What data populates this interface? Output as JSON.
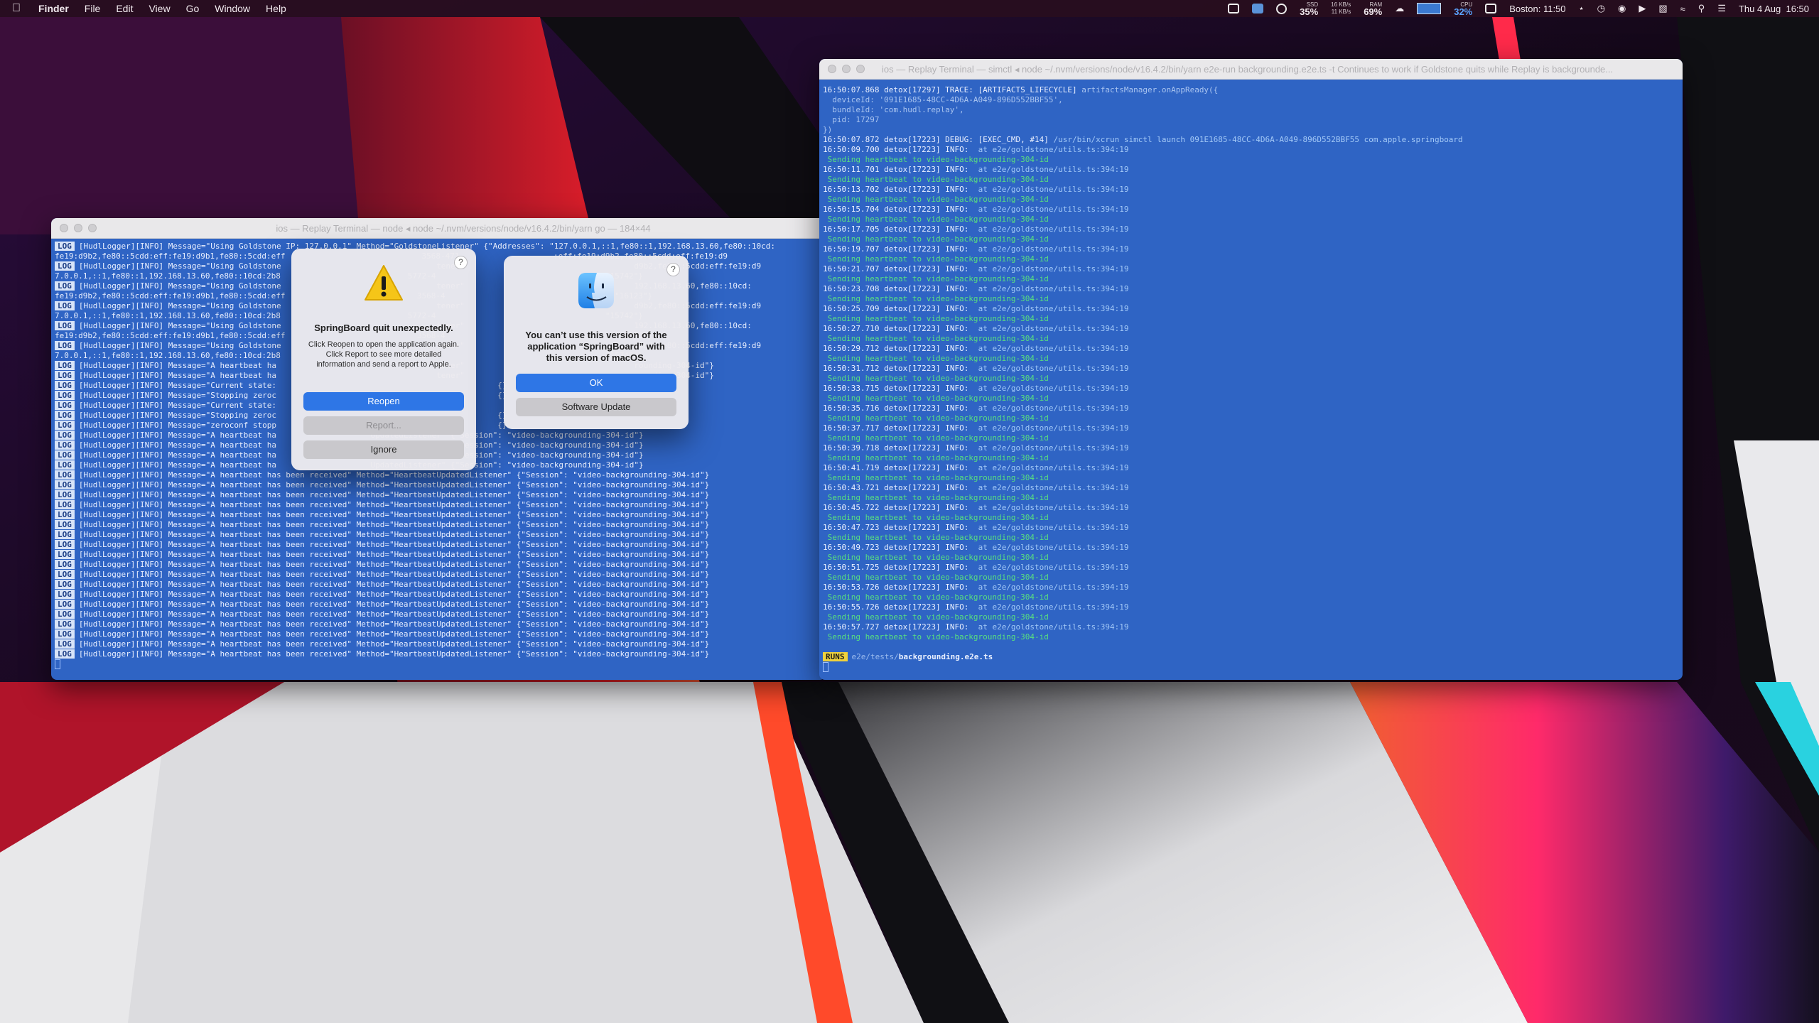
{
  "menubar": {
    "app_name": "Finder",
    "menus": [
      "File",
      "Edit",
      "View",
      "Go",
      "Window",
      "Help"
    ],
    "ssd": {
      "label": "SSD",
      "value": "35%"
    },
    "network": {
      "up": "16 KB/s",
      "down": "11 KB/s"
    },
    "ram": {
      "label": "RAM",
      "value": "69%"
    },
    "cpu": {
      "label": "CPU",
      "value": "32%"
    },
    "clock_city": "Boston: 11:50",
    "datetime": "Thu 4 Aug  16:50"
  },
  "term_left": {
    "title": "ios — Replay Terminal — node ◂ node ~/.nvm/versions/node/v16.4.2/bin/yarn go — 184×44",
    "lines": [
      {
        "badge": "LOG",
        "text": "[HudlLogger][INFO] Message=\"Using Goldstone IP: 127.0.0.1\" Method=\"GoldstoneListener\" {\"Addresses\": \"127.0.0.1,::1,fe80::1,192.168.13.60,fe80::10cd:"
      },
      {
        "badge": "",
        "text": "fe19:d9b2,fe80::5cdd:eff:fe19:d9b1,fe80::5cdd:eff                             3568-471                    :eff:fe19:d9b2,fe80::5cdd:eff:fe19:d9"
      },
      {
        "badge": "LOG",
        "text": "[HudlLogger][INFO] Message=\"Using Goldstone                                 tener\"                                    d9b2,fe80::5cdd:eff:fe19:d9"
      },
      {
        "badge": "",
        "text": "7.0.0.1,::1,fe80::1,192.168.13.60,fe80::10cd:2b8                           5772-4                                    \"15742\"}"
      },
      {
        "badge": "LOG",
        "text": "[HudlLogger][INFO] Message=\"Using Goldstone                                 tener\"                                    192.168.13.60,fe80::10cd:"
      },
      {
        "badge": "",
        "text": "fe19:d9b2,fe80::5cdd:eff:fe19:d9b1,fe80::5cdd:eff                            3568-4                                    \"16123\"}"
      },
      {
        "badge": "LOG",
        "text": "[HudlLogger][INFO] Message=\"Using Goldstone                                 tener\"                                    d9b2,fe80::5cdd:eff:fe19:d9"
      },
      {
        "badge": "",
        "text": "7.0.0.1,::1,fe80::1,192.168.13.60,fe80::10cd:2b8                           5772-4                                    \"15742\"}"
      },
      {
        "badge": "LOG",
        "text": "[HudlLogger][INFO] Message=\"Using Goldstone                                 tener\"                                    192.168.13.60,fe80::10cd:"
      },
      {
        "badge": "",
        "text": "fe19:d9b2,fe80::5cdd:eff:fe19:d9b1,fe80::5cdd:eff                            3568-4                                    \"16123\"}"
      },
      {
        "badge": "LOG",
        "text": "[HudlLogger][INFO] Message=\"Using Goldstone                                 tener\"                                    d9b2,fe80::5cdd:eff:fe19:d9"
      },
      {
        "badge": "",
        "text": "7.0.0.1,::1,fe80::1,192.168.13.60,fe80::10cd:2b8                           5772-4                                    \"15742\"}"
      },
      {
        "badge": "LOG",
        "text": "[HudlLogger][INFO] Message=\"A heartbeat ha                                  tener\"                                    rounding-304-id\"}"
      },
      {
        "badge": "LOG",
        "text": "[HudlLogger][INFO] Message=\"A heartbeat ha                                  tener\"                                    rounding-304-id\"}"
      },
      {
        "badge": "LOG",
        "text": "[HudlLogger][INFO] Message=\"Current state:                                               {}"
      },
      {
        "badge": "LOG",
        "text": "[HudlLogger][INFO] Message=\"Stopping zeroc                                               {}"
      },
      {
        "badge": "LOG",
        "text": "[HudlLogger][INFO] Message=\"Current state:                                  ry\" {"
      },
      {
        "badge": "LOG",
        "text": "[HudlLogger][INFO] Message=\"Stopping zeroc                                               {}"
      },
      {
        "badge": "LOG",
        "text": "[HudlLogger][INFO] Message=\"zeroconf stopp                                               {}"
      },
      {
        "badge": "LOG",
        "text": "[HudlLogger][INFO] Message=\"A heartbeat ha                    UpdatedListener\" {\"Session\": \"video-backgrounding-304-id\"}"
      },
      {
        "badge": "LOG",
        "text": "[HudlLogger][INFO] Message=\"A heartbeat ha                    UpdatedListener\" {\"Session\": \"video-backgrounding-304-id\"}"
      },
      {
        "badge": "LOG",
        "text": "[HudlLogger][INFO] Message=\"A heartbeat ha                    UpdatedListener\" {\"Session\": \"video-backgrounding-304-id\"}"
      },
      {
        "badge": "LOG",
        "text": "[HudlLogger][INFO] Message=\"A heartbeat ha                    UpdatedListener\" {\"Session\": \"video-backgrounding-304-id\"}"
      },
      {
        "badge": "LOG",
        "text": "[HudlLogger][INFO] Message=\"A heartbeat has been received\" Method=\"HeartbeatUpdatedListener\" {\"Session\": \"video-backgrounding-304-id\"}"
      },
      {
        "badge": "LOG",
        "text": "[HudlLogger][INFO] Message=\"A heartbeat has been received\" Method=\"HeartbeatUpdatedListener\" {\"Session\": \"video-backgrounding-304-id\"}"
      },
      {
        "badge": "LOG",
        "text": "[HudlLogger][INFO] Message=\"A heartbeat has been received\" Method=\"HeartbeatUpdatedListener\" {\"Session\": \"video-backgrounding-304-id\"}"
      },
      {
        "badge": "LOG",
        "text": "[HudlLogger][INFO] Message=\"A heartbeat has been received\" Method=\"HeartbeatUpdatedListener\" {\"Session\": \"video-backgrounding-304-id\"}"
      },
      {
        "badge": "LOG",
        "text": "[HudlLogger][INFO] Message=\"A heartbeat has been received\" Method=\"HeartbeatUpdatedListener\" {\"Session\": \"video-backgrounding-304-id\"}"
      },
      {
        "badge": "LOG",
        "text": "[HudlLogger][INFO] Message=\"A heartbeat has been received\" Method=\"HeartbeatUpdatedListener\" {\"Session\": \"video-backgrounding-304-id\"}"
      },
      {
        "badge": "LOG",
        "text": "[HudlLogger][INFO] Message=\"A heartbeat has been received\" Method=\"HeartbeatUpdatedListener\" {\"Session\": \"video-backgrounding-304-id\"}"
      },
      {
        "badge": "LOG",
        "text": "[HudlLogger][INFO] Message=\"A heartbeat has been received\" Method=\"HeartbeatUpdatedListener\" {\"Session\": \"video-backgrounding-304-id\"}"
      },
      {
        "badge": "LOG",
        "text": "[HudlLogger][INFO] Message=\"A heartbeat has been received\" Method=\"HeartbeatUpdatedListener\" {\"Session\": \"video-backgrounding-304-id\"}"
      },
      {
        "badge": "LOG",
        "text": "[HudlLogger][INFO] Message=\"A heartbeat has been received\" Method=\"HeartbeatUpdatedListener\" {\"Session\": \"video-backgrounding-304-id\"}"
      },
      {
        "badge": "LOG",
        "text": "[HudlLogger][INFO] Message=\"A heartbeat has been received\" Method=\"HeartbeatUpdatedListener\" {\"Session\": \"video-backgrounding-304-id\"}"
      },
      {
        "badge": "LOG",
        "text": "[HudlLogger][INFO] Message=\"A heartbeat has been received\" Method=\"HeartbeatUpdatedListener\" {\"Session\": \"video-backgrounding-304-id\"}"
      },
      {
        "badge": "LOG",
        "text": "[HudlLogger][INFO] Message=\"A heartbeat has been received\" Method=\"HeartbeatUpdatedListener\" {\"Session\": \"video-backgrounding-304-id\"}"
      },
      {
        "badge": "LOG",
        "text": "[HudlLogger][INFO] Message=\"A heartbeat has been received\" Method=\"HeartbeatUpdatedListener\" {\"Session\": \"video-backgrounding-304-id\"}"
      },
      {
        "badge": "LOG",
        "text": "[HudlLogger][INFO] Message=\"A heartbeat has been received\" Method=\"HeartbeatUpdatedListener\" {\"Session\": \"video-backgrounding-304-id\"}"
      },
      {
        "badge": "LOG",
        "text": "[HudlLogger][INFO] Message=\"A heartbeat has been received\" Method=\"HeartbeatUpdatedListener\" {\"Session\": \"video-backgrounding-304-id\"}"
      },
      {
        "badge": "LOG",
        "text": "[HudlLogger][INFO] Message=\"A heartbeat has been received\" Method=\"HeartbeatUpdatedListener\" {\"Session\": \"video-backgrounding-304-id\"}"
      },
      {
        "badge": "LOG",
        "text": "[HudlLogger][INFO] Message=\"A heartbeat has been received\" Method=\"HeartbeatUpdatedListener\" {\"Session\": \"video-backgrounding-304-id\"}"
      },
      {
        "badge": "LOG",
        "text": "[HudlLogger][INFO] Message=\"A heartbeat has been received\" Method=\"HeartbeatUpdatedListener\" {\"Session\": \"video-backgrounding-304-id\"}"
      }
    ]
  },
  "term_right": {
    "title": "ios — Replay Terminal — simctl ◂ node ~/.nvm/versions/node/v16.4.2/bin/yarn e2e-run backgrounding.e2e.ts -t Continues to work if Goldstone quits while Replay is backgrounde...",
    "header_lines": [
      {
        "prefix": "16:50:07.868 detox[17297] TRACE: [ARTIFACTS_LIFECYCLE] ",
        "rest": "artifactsManager.onAppReady({"
      },
      {
        "prefix": "",
        "rest": "  deviceId: '091E1685-48CC-4D6A-A049-896D552BBF55',"
      },
      {
        "prefix": "",
        "rest": "  bundleId: 'com.hudl.replay',"
      },
      {
        "prefix": "",
        "rest": "  pid: 17297"
      },
      {
        "prefix": "",
        "rest": "})"
      },
      {
        "prefix": "16:50:07.872 detox[17223] DEBUG: [EXEC_CMD, #14] ",
        "rest": "/usr/bin/xcrun simctl launch 091E1685-48CC-4D6A-A049-896D552BBF55 com.apple.springboard"
      }
    ],
    "heartbeats": [
      {
        "ts": "16:50:09.700",
        "pid": "17223"
      },
      {
        "ts": "16:50:11.701",
        "pid": "17223"
      },
      {
        "ts": "16:50:13.702",
        "pid": "17223"
      },
      {
        "ts": "16:50:15.704",
        "pid": "17223"
      },
      {
        "ts": "16:50:17.705",
        "pid": "17223"
      },
      {
        "ts": "16:50:19.707",
        "pid": "17223"
      },
      {
        "ts": "16:50:21.707",
        "pid": "17223"
      },
      {
        "ts": "16:50:23.708",
        "pid": "17223"
      },
      {
        "ts": "16:50:25.709",
        "pid": "17223"
      },
      {
        "ts": "16:50:27.710",
        "pid": "17223"
      },
      {
        "ts": "16:50:29.712",
        "pid": "17223"
      },
      {
        "ts": "16:50:31.712",
        "pid": "17223"
      },
      {
        "ts": "16:50:33.715",
        "pid": "17223"
      },
      {
        "ts": "16:50:35.716",
        "pid": "17223"
      },
      {
        "ts": "16:50:37.717",
        "pid": "17223"
      },
      {
        "ts": "16:50:39.718",
        "pid": "17223"
      },
      {
        "ts": "16:50:41.719",
        "pid": "17223"
      },
      {
        "ts": "16:50:43.721",
        "pid": "17223"
      },
      {
        "ts": "16:50:45.722",
        "pid": "17223"
      },
      {
        "ts": "16:50:47.723",
        "pid": "17223"
      },
      {
        "ts": "16:50:49.723",
        "pid": "17223"
      },
      {
        "ts": "16:50:51.725",
        "pid": "17223"
      },
      {
        "ts": "16:50:53.726",
        "pid": "17223"
      },
      {
        "ts": "16:50:55.726",
        "pid": "17223"
      },
      {
        "ts": "16:50:57.727",
        "pid": "17223"
      }
    ],
    "hb_level": "INFO:",
    "hb_location": "at e2e/goldstone/utils.ts:394:19",
    "hb_message": " Sending heartbeat to video-backgrounding-304-id",
    "runs_badge": "RUNS",
    "runs_dir": "e2e/tests/",
    "runs_file": "backgrounding.e2e.ts"
  },
  "dialog_crash": {
    "title": "SpringBoard quit unexpectedly.",
    "message": "Click Reopen to open the application again. Click Report to see more detailed information and send a report to Apple.",
    "reopen": "Reopen",
    "report": "Report...",
    "ignore": "Ignore",
    "help": "?"
  },
  "dialog_version": {
    "title": "You can’t use this version of the application “SpringBoard” with this version of macOS.",
    "ok": "OK",
    "update": "Software Update",
    "help": "?"
  }
}
